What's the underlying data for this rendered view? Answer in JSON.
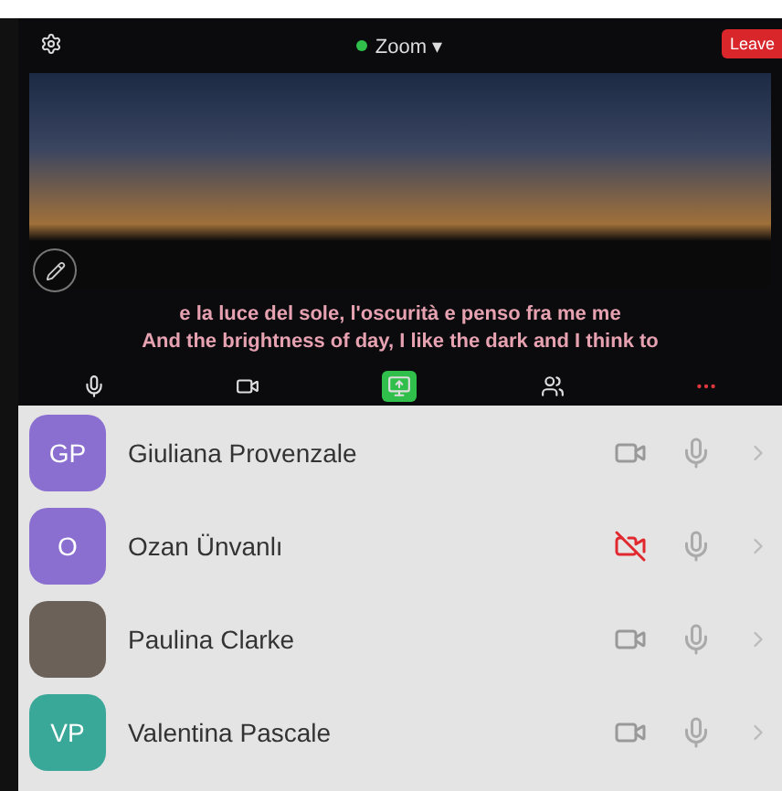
{
  "meeting": {
    "title": "Zoom",
    "title_caret": "▾",
    "leave_label": "Leave",
    "subtitles": [
      "e la luce del sole, l'oscurità e penso fra me me",
      "And the brightness of day, I like the dark and I think to"
    ]
  },
  "toolbar": [
    {
      "kind": "mic"
    },
    {
      "kind": "video"
    },
    {
      "kind": "share"
    },
    {
      "kind": "participants"
    },
    {
      "kind": "more"
    }
  ],
  "participants": [
    {
      "name": "Giuliana Provenzale",
      "kind": "initials",
      "initials": "GP",
      "color": "#8a6fd1",
      "video_on": true
    },
    {
      "name": "Ozan Ünvanlı",
      "kind": "initials",
      "initials": "O",
      "color": "#8a6fd1",
      "video_on": false
    },
    {
      "name": "Paulina Clarke",
      "kind": "photo",
      "video_on": true
    },
    {
      "name": "Valentina Pascale",
      "kind": "initials",
      "initials": "VP",
      "color": "#3aa899",
      "video_on": true
    }
  ]
}
